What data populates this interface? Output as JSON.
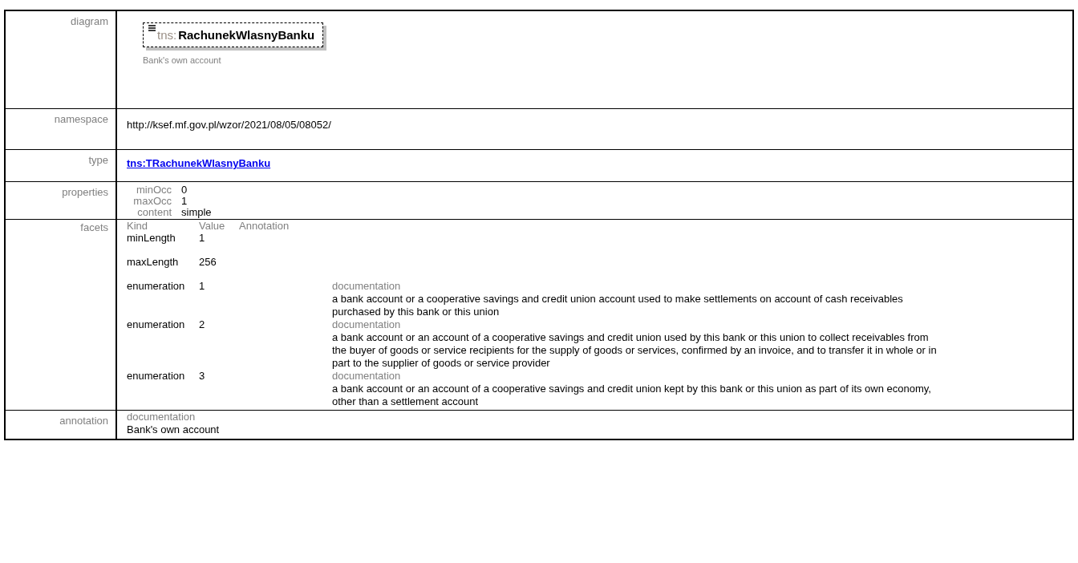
{
  "diagram": {
    "label": "diagram",
    "prefix": "tns:",
    "name": "RachunekWlasnyBanku",
    "caption": "Bank's own account"
  },
  "namespace": {
    "label": "namespace",
    "value": "http://ksef.mf.gov.pl/wzor/2021/08/05/08052/"
  },
  "type": {
    "label": "type",
    "link": "tns:TRachunekWlasnyBanku"
  },
  "properties": {
    "label": "properties",
    "items": [
      {
        "name": "minOcc",
        "value": "0"
      },
      {
        "name": "maxOcc",
        "value": "1"
      },
      {
        "name": "content",
        "value": "simple"
      }
    ]
  },
  "facets": {
    "label": "facets",
    "columns": [
      "Kind",
      "Value",
      "Annotation"
    ],
    "rows": [
      {
        "kind": "minLength",
        "value": "1"
      },
      {
        "kind": "maxLength",
        "value": "256"
      },
      {
        "kind": "enumeration",
        "value": "1",
        "doc_label": "documentation",
        "doc": "a bank account or a cooperative savings and credit union account used to make settlements on account of cash receivables purchased by this bank or this union"
      },
      {
        "kind": "enumeration",
        "value": "2",
        "doc_label": "documentation",
        "doc": "a bank account or an account of a cooperative savings and credit union used by this bank or this union to collect receivables from the buyer of goods or service recipients for the supply of goods or services, confirmed by an invoice, and to transfer it in whole or in part to the supplier of goods or service provider"
      },
      {
        "kind": "enumeration",
        "value": "3",
        "doc_label": "documentation",
        "doc": "a bank account or an account of a cooperative savings and credit union kept by this bank or this union as part of its own economy, other than a settlement account"
      }
    ]
  },
  "annotation": {
    "label": "annotation",
    "doc_label": "documentation",
    "text": "Bank's own account"
  }
}
